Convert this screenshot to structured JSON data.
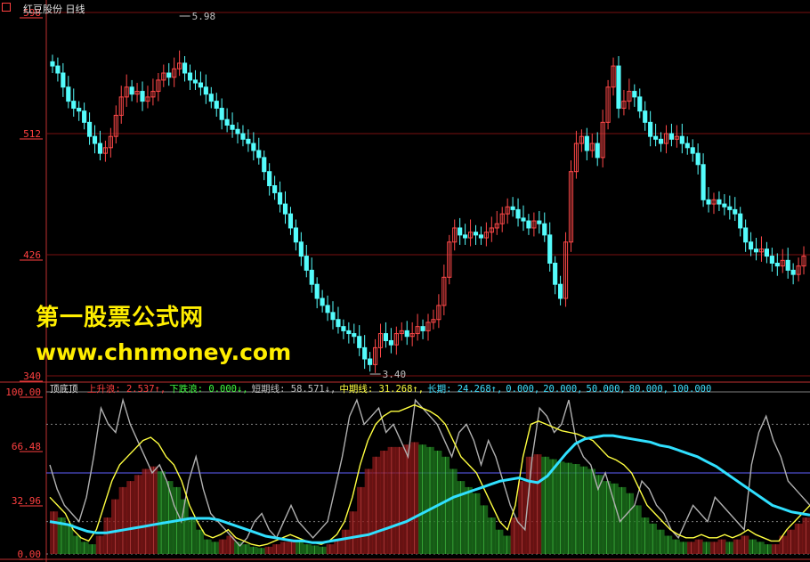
{
  "window": {
    "title": "红豆股份 日线"
  },
  "watermark": {
    "line1": "第一股票公式网",
    "line2": "www.chnmoney.com"
  },
  "indicator": {
    "name": "顶底顶",
    "items": [
      {
        "label": "上升浪:",
        "value": "2.537",
        "arrow": "↑",
        "color": "#ff4040"
      },
      {
        "label": "下跌浪:",
        "value": "0.000",
        "arrow": "↓",
        "color": "#40ff40"
      },
      {
        "label": "短期线:",
        "value": "58.571",
        "arrow": "↓",
        "color": "#c0c0c0"
      },
      {
        "label": "中期线:",
        "value": "31.268",
        "arrow": "↑",
        "color": "#ffff40"
      },
      {
        "label": "长期:",
        "value": "24.268",
        "arrow": "↑",
        "color": "#40e0ff"
      }
    ],
    "extra_values": [
      "0.000",
      "20.000",
      "50.000",
      "80.000",
      "100.000"
    ],
    "extra_color": "#40e0ff"
  },
  "chart_data": [
    {
      "type": "candlestick",
      "title": "红豆股份 日线",
      "y_ticks": [
        "598",
        "512",
        "426",
        "340"
      ],
      "ylim": [
        3.4,
        5.98
      ],
      "annotations": [
        {
          "text": "5.98",
          "kind": "high"
        },
        {
          "text": "3.40",
          "kind": "low"
        }
      ],
      "close_series": [
        5.6,
        5.55,
        5.45,
        5.35,
        5.3,
        5.28,
        5.2,
        5.1,
        5.05,
        4.98,
        5.02,
        5.1,
        5.25,
        5.38,
        5.45,
        5.4,
        5.42,
        5.35,
        5.38,
        5.42,
        5.5,
        5.55,
        5.52,
        5.58,
        5.62,
        5.55,
        5.5,
        5.48,
        5.45,
        5.4,
        5.35,
        5.3,
        5.22,
        5.18,
        5.15,
        5.12,
        5.08,
        5.05,
        5.0,
        4.95,
        4.85,
        4.75,
        4.7,
        4.62,
        4.55,
        4.45,
        4.35,
        4.25,
        4.15,
        4.05,
        3.95,
        3.9,
        3.85,
        3.8,
        3.75,
        3.72,
        3.7,
        3.68,
        3.6,
        3.52,
        3.48,
        3.6,
        3.7,
        3.65,
        3.62,
        3.7,
        3.72,
        3.68,
        3.7,
        3.75,
        3.72,
        3.78,
        3.8,
        3.9,
        4.1,
        4.35,
        4.45,
        4.4,
        4.38,
        4.42,
        4.4,
        4.38,
        4.42,
        4.45,
        4.48,
        4.55,
        4.6,
        4.58,
        4.52,
        4.5,
        4.45,
        4.5,
        4.48,
        4.4,
        4.2,
        4.05,
        3.95,
        4.35,
        4.85,
        5.05,
        5.1,
        5.0,
        5.05,
        4.95,
        5.2,
        5.45,
        5.6,
        5.3,
        5.35,
        5.42,
        5.38,
        5.28,
        5.2,
        5.1,
        5.08,
        5.05,
        5.12,
        5.08,
        5.1,
        5.05,
        5.02,
        4.98,
        4.9,
        4.65,
        4.62,
        4.65,
        4.62,
        4.6,
        4.58,
        4.55,
        4.45,
        4.35,
        4.3,
        4.28,
        4.3,
        4.25,
        4.2,
        4.18,
        4.22,
        4.15,
        4.12,
        4.18,
        4.25
      ]
    },
    {
      "type": "line",
      "title": "顶底顶",
      "y_ticks": [
        "100.00",
        "66.48",
        "32.96",
        "0.00"
      ],
      "ylim": [
        0,
        100
      ],
      "reference_lines": [
        0,
        20,
        50,
        80,
        100
      ],
      "series": [
        {
          "name": "短期线",
          "color": "#b0b0b0",
          "values": [
            55,
            40,
            30,
            25,
            20,
            35,
            60,
            90,
            80,
            75,
            95,
            80,
            70,
            60,
            50,
            55,
            45,
            30,
            20,
            45,
            60,
            40,
            25,
            20,
            15,
            10,
            5,
            10,
            20,
            25,
            15,
            10,
            20,
            30,
            20,
            15,
            10,
            15,
            20,
            40,
            60,
            85,
            95,
            80,
            85,
            90,
            75,
            80,
            70,
            60,
            95,
            90,
            85,
            80,
            70,
            60,
            75,
            80,
            70,
            55,
            70,
            60,
            45,
            30,
            20,
            15,
            60,
            90,
            85,
            75,
            80,
            95,
            70,
            60,
            55,
            40,
            50,
            35,
            20,
            25,
            30,
            45,
            40,
            30,
            25,
            15,
            10,
            20,
            30,
            25,
            20,
            35,
            30,
            25,
            20,
            15,
            55,
            75,
            85,
            70,
            60,
            45,
            40,
            35,
            30
          ]
        },
        {
          "name": "中期线",
          "color": "#ffff40",
          "values": [
            35,
            30,
            25,
            15,
            10,
            8,
            15,
            30,
            45,
            55,
            60,
            65,
            70,
            72,
            68,
            60,
            55,
            45,
            30,
            20,
            12,
            10,
            12,
            15,
            10,
            8,
            6,
            5,
            6,
            8,
            10,
            12,
            10,
            8,
            7,
            6,
            8,
            12,
            20,
            35,
            55,
            70,
            80,
            85,
            88,
            88,
            90,
            92,
            90,
            88,
            85,
            80,
            70,
            60,
            55,
            50,
            40,
            30,
            20,
            15,
            30,
            60,
            80,
            82,
            80,
            78,
            76,
            75,
            74,
            72,
            70,
            65,
            60,
            58,
            55,
            50,
            40,
            30,
            25,
            20,
            15,
            12,
            10,
            10,
            12,
            10,
            10,
            12,
            10,
            12,
            15,
            12,
            10,
            8,
            8,
            15,
            20,
            25,
            30
          ]
        },
        {
          "name": "长期线",
          "color": "#30e0ff",
          "values": [
            20,
            19,
            18,
            16,
            14,
            13,
            13,
            14,
            15,
            16,
            17,
            18,
            19,
            20,
            21,
            22,
            22,
            22,
            21,
            19,
            17,
            15,
            13,
            11,
            10,
            9,
            8,
            8,
            7,
            7,
            8,
            9,
            10,
            11,
            12,
            14,
            16,
            18,
            20,
            23,
            26,
            29,
            32,
            35,
            37,
            39,
            41,
            43,
            45,
            46,
            47,
            45,
            44,
            48,
            55,
            62,
            68,
            71,
            72,
            73,
            73,
            72,
            71,
            70,
            69,
            67,
            66,
            64,
            62,
            60,
            57,
            54,
            50,
            46,
            42,
            38,
            34,
            30,
            28,
            26,
            25,
            24
          ]
        }
      ]
    }
  ]
}
